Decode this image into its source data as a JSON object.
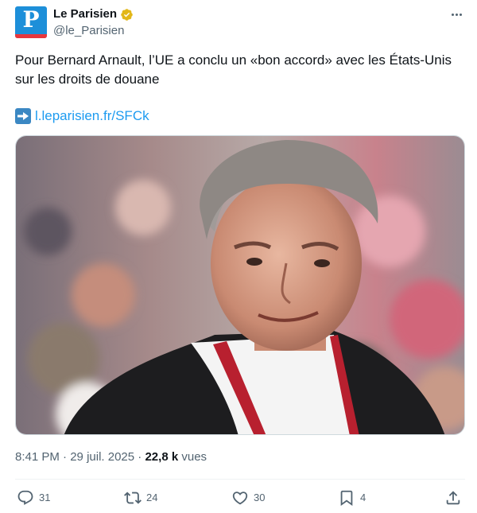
{
  "account": {
    "display_name": "Le Parisien",
    "handle": "@le_Parisien",
    "avatar_letter": "P",
    "verified_badge": "gold-verified-icon"
  },
  "tweet": {
    "text": "Pour Bernard Arnault, l’UE a conclu un «bon accord» avec les États-Unis sur les droits de douane",
    "link_icon": "right-arrow-emoji-icon",
    "link_text": "l.leparisien.fr/SFCk",
    "media_description_icon": "photo"
  },
  "meta": {
    "time": "8:41 PM",
    "separator1": " · ",
    "date": "29 juil. 2025",
    "separator2": " · ",
    "views_count": "22,8 k",
    "views_label": " vues"
  },
  "actions": {
    "replies": "31",
    "reposts": "24",
    "likes": "30",
    "bookmarks": "4"
  },
  "colors": {
    "link": "#1d9bf0",
    "secondary_text": "#536471",
    "avatar_bg": "#1d8fd9",
    "avatar_stripe": "#e8373d",
    "verified_gold": "#e2b719"
  }
}
